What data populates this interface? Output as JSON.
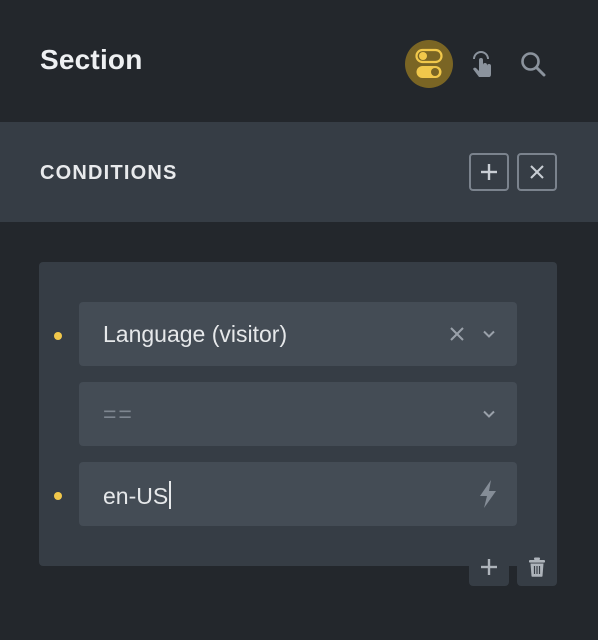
{
  "header": {
    "title": "Section",
    "icons": [
      "toggle-icon",
      "touch-icon",
      "search-icon"
    ]
  },
  "conditions": {
    "title": "CONDITIONS",
    "add_icon": "plus-icon",
    "close_icon": "close-icon"
  },
  "condition": {
    "key": "Language (visitor)",
    "operator_placeholder": "==",
    "value": "en-US",
    "clear_icon": "close-icon",
    "dropdown_icon": "chevron-down-icon",
    "dynamic_icon": "lightning-icon"
  },
  "actions": {
    "add_icon": "plus-icon",
    "delete_icon": "trash-icon"
  },
  "colors": {
    "accent": "#f1c84b",
    "background": "#23272c",
    "panel": "#363d45",
    "field": "#444c55"
  }
}
